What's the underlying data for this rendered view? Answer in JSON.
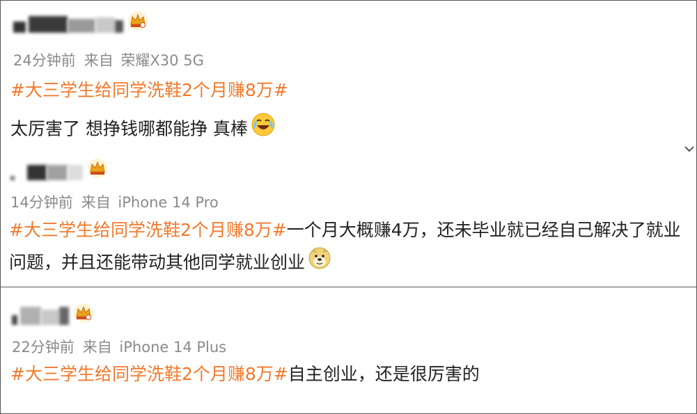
{
  "posts": [
    {
      "time": "24分钟前",
      "source_label": "来自",
      "device": "荣耀X30 5G",
      "hashtag": "#大三学生给同学洗鞋2个月赚8万#",
      "text": "太厉害了 想挣钱哪都能挣 真棒",
      "emoji": "laugh-cry-emoji",
      "badge": "crown-badge"
    },
    {
      "time": "14分钟前",
      "source_label": "来自",
      "device": "iPhone 14 Pro",
      "hashtag": "#大三学生给同学洗鞋2个月赚8万#",
      "text": "一个月大概赚4万，还未毕业就已经自己解决了就业问题，并且还能带动其他同学就业创业",
      "emoji": "doge-emoji",
      "badge": "crown-badge"
    },
    {
      "time": "22分钟前",
      "source_label": "来自",
      "device": "iPhone 14 Plus",
      "hashtag": "#大三学生给同学洗鞋2个月赚8万#",
      "text": "自主创业，还是很厉害的",
      "badge": "crown-badge"
    }
  ],
  "colors": {
    "hashtag": "#f07a2e",
    "meta": "#8a8a8a",
    "text": "#222222",
    "crown": "#e8a317"
  },
  "icons": {
    "collapse": "chevron-down-icon"
  }
}
